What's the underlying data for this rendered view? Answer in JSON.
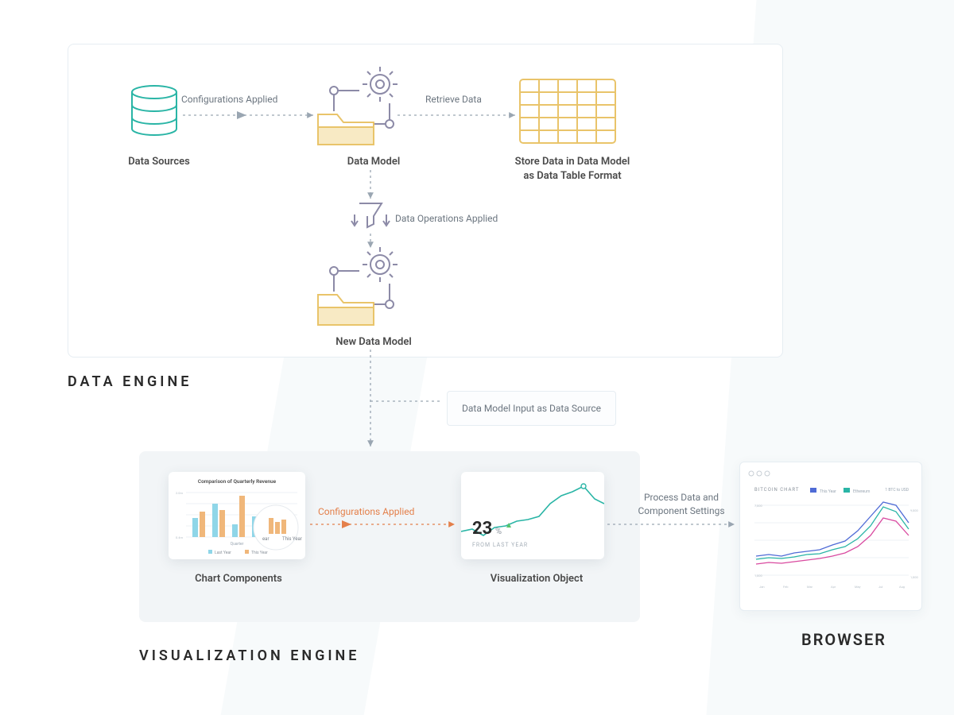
{
  "sections": {
    "data_engine": "DATA ENGINE",
    "visualization_engine": "VISUALIZATION ENGINE",
    "browser": "BROWSER"
  },
  "nodes": {
    "data_sources": "Data Sources",
    "data_model": "Data Model",
    "store_data": "Store Data in Data Model\nas Data Table Format",
    "data_operations": "Data Operations Applied",
    "new_data_model": "New Data Model",
    "chart_components": "Chart Components",
    "visualization_object": "Visualization Object",
    "data_model_input": "Data Model Input as Data Source"
  },
  "edges": {
    "configs_applied_top": "Configurations Applied",
    "retrieve_data": "Retrieve Data",
    "configs_applied_mid": "Configurations Applied",
    "process_data": "Process Data and\nComponent Settings"
  },
  "thumbnails": {
    "chart_title": "Comparison of Quarterly Revenue",
    "legend_last": "Last Year",
    "legend_this": "This Year",
    "lens_label_left": "ear",
    "lens_label_right": "This Year",
    "axis_quarter": "Quarter",
    "viz_value": "23",
    "viz_pct": "%",
    "viz_caption": "FROM LAST YEAR",
    "browser_chart_title": "BITCOIN CHART",
    "browser_rate": "1 BTC to USD"
  },
  "colors": {
    "grey_dash": "#9aa6b2",
    "orange_dash": "#e4804b",
    "teal": "#2ab5a6",
    "yellow": "#e9c46a",
    "purple": "#8c8aa7"
  }
}
